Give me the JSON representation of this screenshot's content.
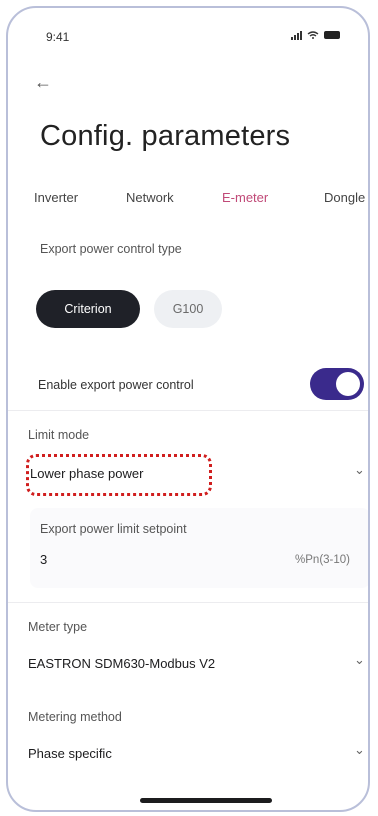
{
  "status_bar": {
    "time": "9:41"
  },
  "page": {
    "title": "Config. parameters",
    "back_label": "←"
  },
  "tabs": [
    {
      "label": "Inverter",
      "active": false
    },
    {
      "label": "Network",
      "active": false
    },
    {
      "label": "E-meter",
      "active": true
    },
    {
      "label": "Dongle",
      "active": false
    }
  ],
  "export_control": {
    "label": "Export power control type",
    "options": [
      {
        "label": "Criterion",
        "selected": true
      },
      {
        "label": "G100",
        "selected": false
      }
    ]
  },
  "enable_export": {
    "label": "Enable export power control",
    "on": true
  },
  "limit_mode": {
    "label": "Limit mode",
    "value": "Lower phase power"
  },
  "export_setpoint": {
    "label": "Export power limit setpoint",
    "value": "3",
    "unit": "%Pn(3-10)"
  },
  "meter_type": {
    "label": "Meter type",
    "value": "EASTRON SDM630-Modbus V2"
  },
  "metering_method": {
    "label": "Metering method",
    "value": "Phase specific"
  },
  "chevron": "⌄",
  "colors": {
    "accent": "#c14a78",
    "toggle_on": "#3a2a8c",
    "highlight": "#d01e1e"
  }
}
